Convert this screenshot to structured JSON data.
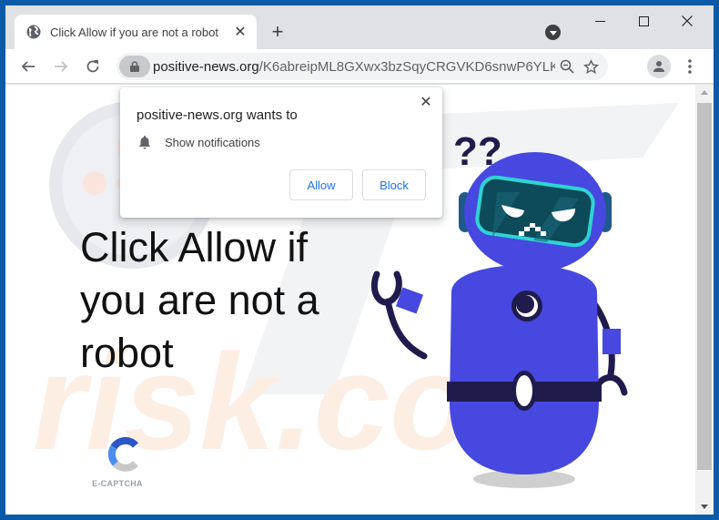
{
  "browser": {
    "tab": {
      "title": "Click Allow if you are not a robot",
      "icon": "globe-icon"
    },
    "new_tab_label": "+",
    "window_controls": [
      "minimize",
      "maximize",
      "close"
    ],
    "address_bar": {
      "domain": "positive-news.org",
      "path": "/K6abreipML8GXwx3bzSqyCRGVKD6snwP6YLK..."
    }
  },
  "popup": {
    "title": "positive-news.org wants to",
    "permission": "Show notifications",
    "allow_label": "Allow",
    "block_label": "Block",
    "close_label": "✕"
  },
  "page": {
    "headline": "Click Allow if you are not a robot",
    "captcha_label": "E-CAPTCHA",
    "illustration": "confused-robot"
  },
  "colors": {
    "accent": "#1a73e8",
    "robot_body": "#4648e0",
    "robot_dark": "#1f1c4d",
    "visor": "#0d4a5a",
    "visor_rim": "#2fd4d4",
    "window_frame": "#0a5aa8"
  }
}
